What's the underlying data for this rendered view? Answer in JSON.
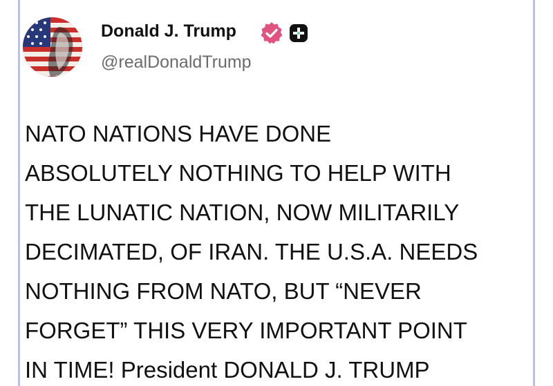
{
  "post": {
    "author": {
      "display_name": "Donald J. Trump",
      "handle": "@realDonaldTrump",
      "avatar_icon": "flag-portrait-avatar",
      "verified_icon": "verified-badge-icon",
      "plus_icon": "plus-badge-icon"
    },
    "lines": [
      "NATO NATIONS HAVE DONE",
      "ABSOLUTELY NOTHING TO HELP WITH",
      "THE LUNATIC NATION, NOW MILITARILY",
      "DECIMATED, OF IRAN. THE U.S.A. NEEDS",
      "NOTHING FROM NATO, BUT “NEVER",
      "FORGET” THIS VERY IMPORTANT POINT",
      "IN TIME! President DONALD J. TRUMP"
    ]
  },
  "colors": {
    "verified_badge": "#e0527f",
    "plus_badge": "#111111",
    "side_rule": "#b8c0ec",
    "text": "#111111",
    "handle_text": "#6b6b6b"
  }
}
